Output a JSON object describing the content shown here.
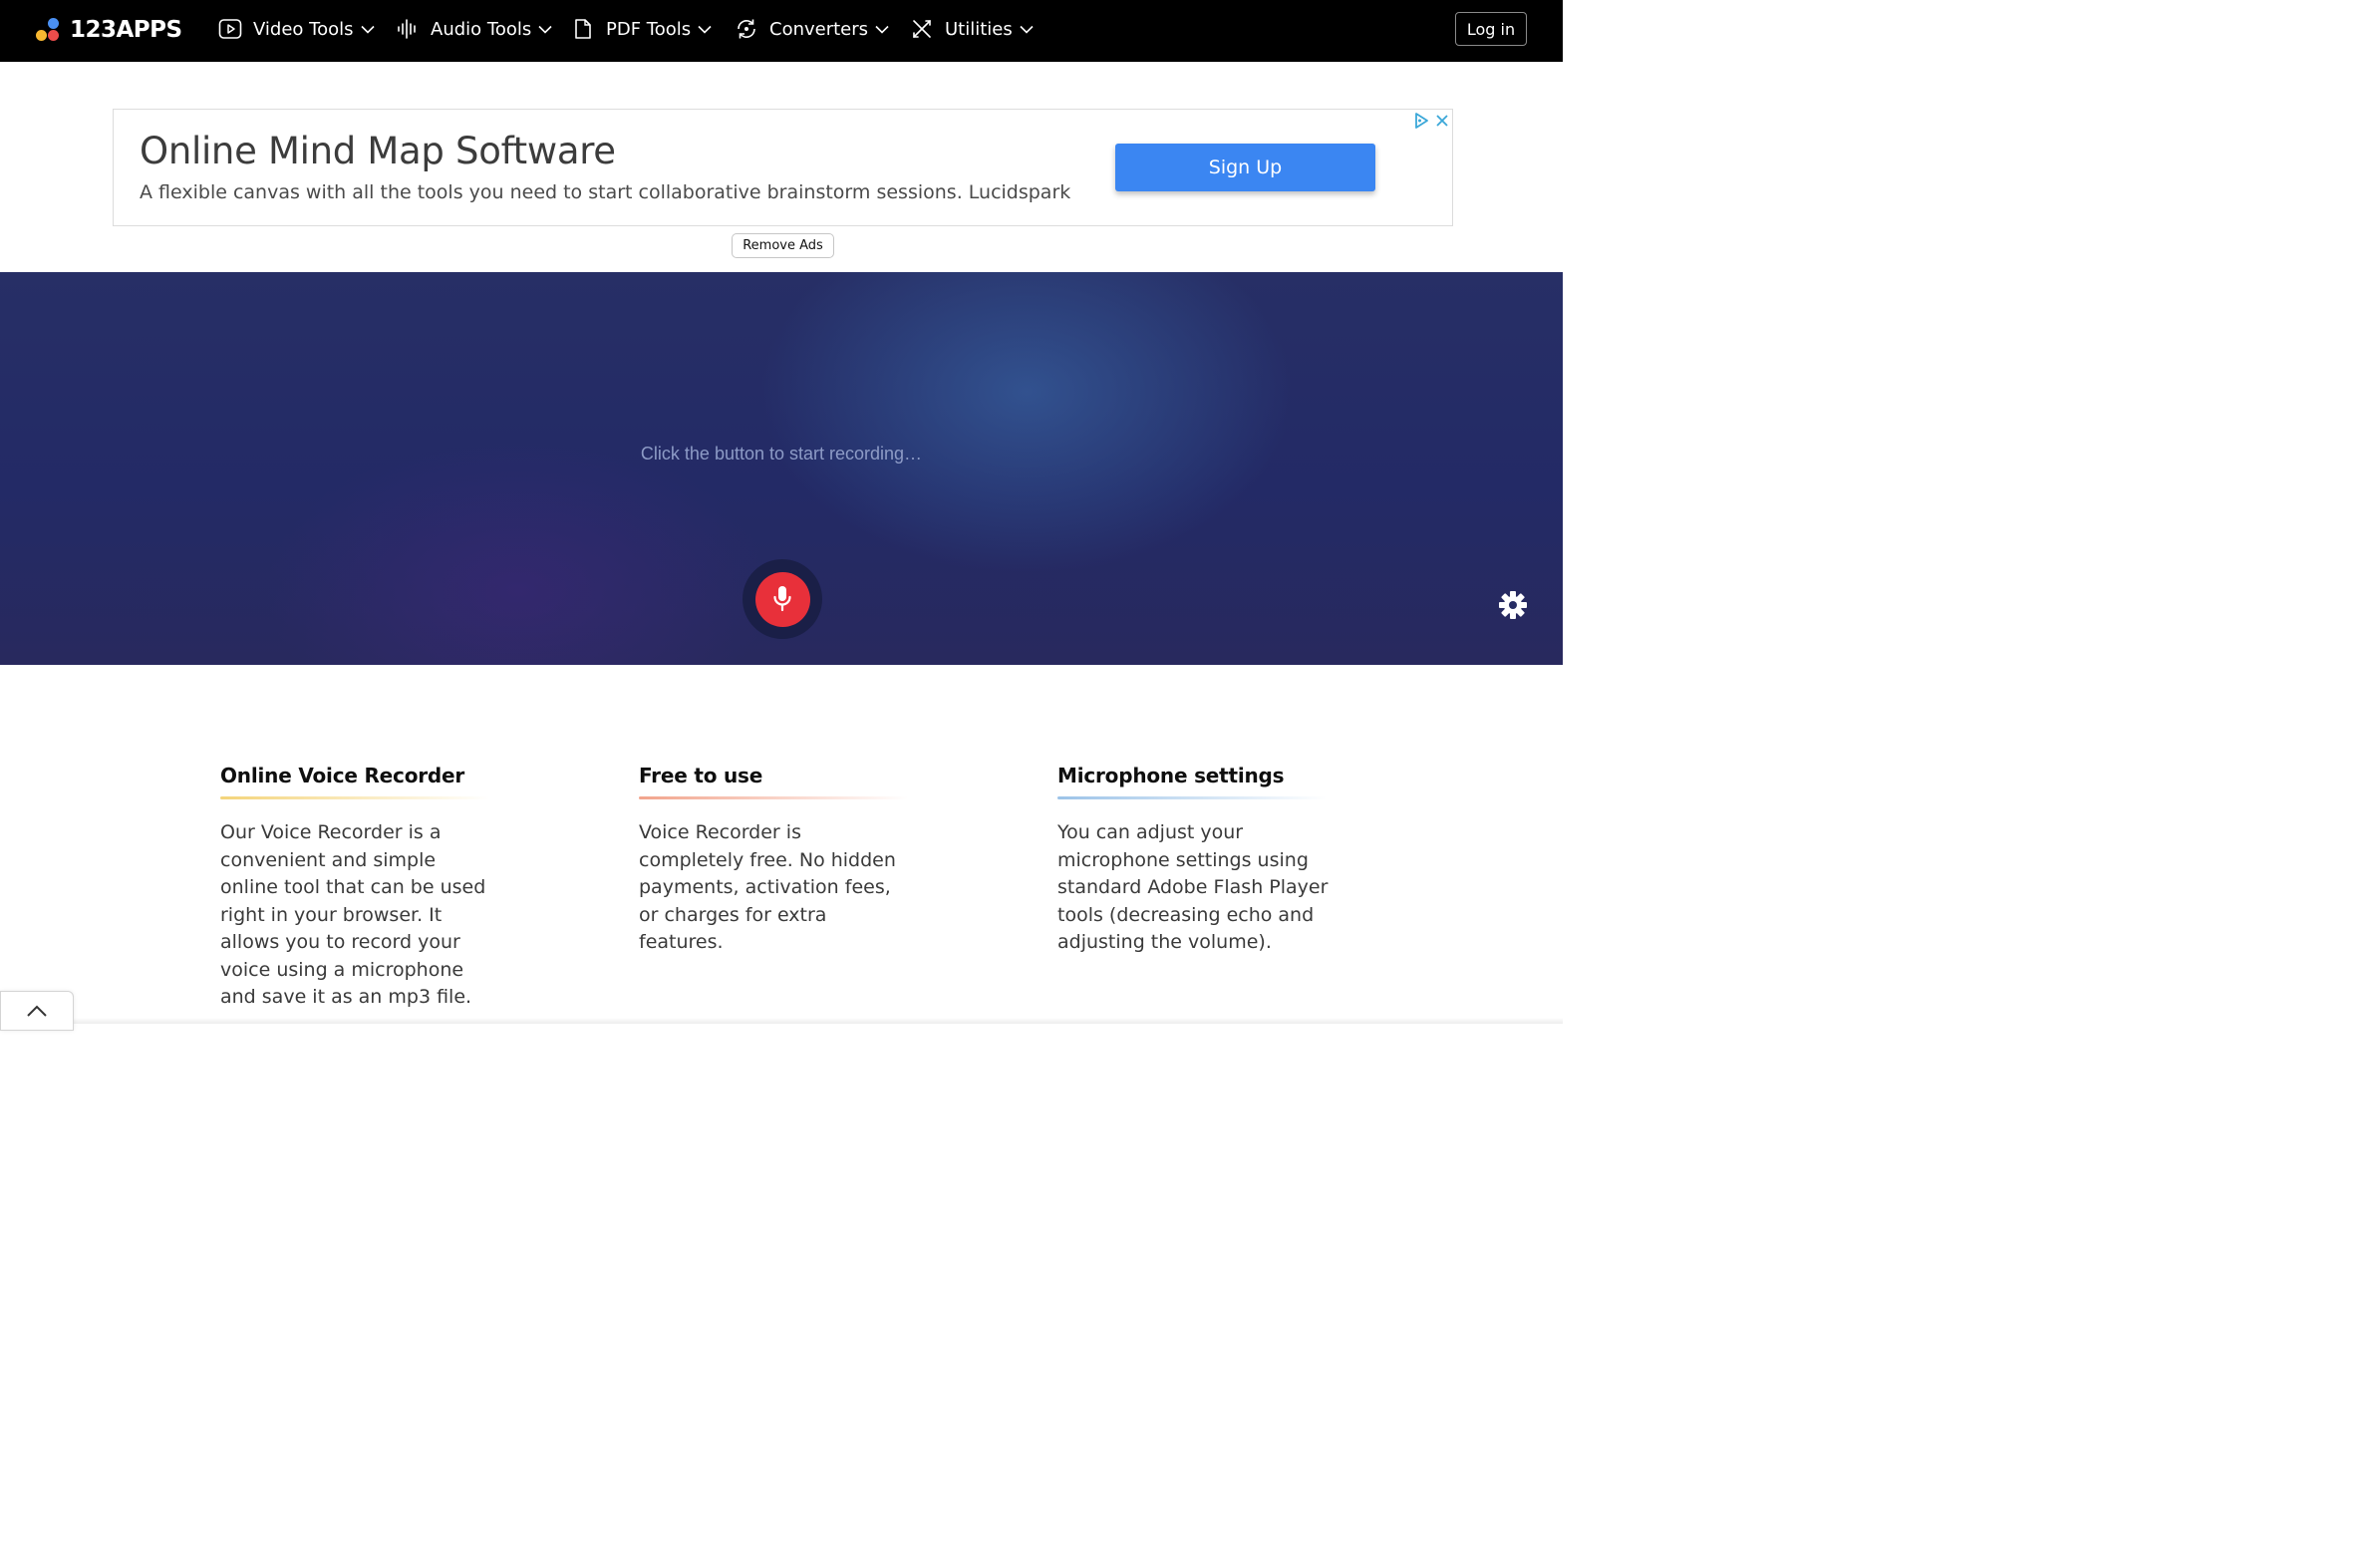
{
  "header": {
    "logo_text": "123APPS",
    "logo_dot_colors": [
      "#f7b731",
      "#eb4d4b",
      "#4a90f3"
    ],
    "nav": [
      {
        "label": "Video Tools",
        "icon": "video-play-icon"
      },
      {
        "label": "Audio Tools",
        "icon": "audio-wave-icon"
      },
      {
        "label": "PDF Tools",
        "icon": "document-icon"
      },
      {
        "label": "Converters",
        "icon": "convert-cycle-icon"
      },
      {
        "label": "Utilities",
        "icon": "tools-icon"
      }
    ],
    "login_label": "Log in"
  },
  "ad": {
    "title": "Online Mind Map Software",
    "description": "A flexible canvas with all the tools you need to start collaborative brainstorm sessions. Lucidspark",
    "cta_label": "Sign Up",
    "cta_color": "#3b86f2",
    "remove_ads_label": "Remove Ads"
  },
  "recorder": {
    "prompt": "Click the button to start recording…",
    "mic_color": "#e8303a"
  },
  "features": [
    {
      "title": "Online Voice Recorder",
      "text": "Our Voice Recorder is a convenient and simple online tool that can be used right in your browser. It allows you to record your voice using a microphone and save it as an mp3 file.",
      "accent": "#f4d47a"
    },
    {
      "title": "Free to use",
      "text": "Voice Recorder is completely free. No hidden payments, activation fees, or charges for extra features.",
      "accent": "#f2a48c"
    },
    {
      "title": "Microphone settings",
      "text": "You can adjust your microphone settings using standard Adobe Flash Player tools (decreasing echo and adjusting the volume).",
      "accent": "#9cc3e8"
    }
  ]
}
